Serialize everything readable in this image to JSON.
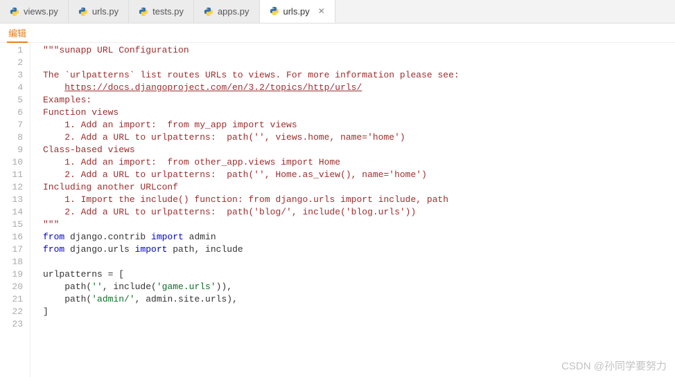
{
  "tabs": [
    {
      "label": "views.py",
      "active": false,
      "closeable": false
    },
    {
      "label": "urls.py",
      "active": false,
      "closeable": false
    },
    {
      "label": "tests.py",
      "active": false,
      "closeable": false
    },
    {
      "label": "apps.py",
      "active": false,
      "closeable": false
    },
    {
      "label": "urls.py",
      "active": true,
      "closeable": true
    }
  ],
  "subbar": {
    "label": "编辑"
  },
  "close_glyph": "✕",
  "code": {
    "lines": [
      {
        "n": 1,
        "segs": [
          {
            "t": "\"\"\"sunapp URL Configuration",
            "cls": "c-docstring"
          }
        ]
      },
      {
        "n": 2,
        "segs": [
          {
            "t": "",
            "cls": "c-docstring"
          }
        ]
      },
      {
        "n": 3,
        "segs": [
          {
            "t": "The `urlpatterns` list routes URLs to views. For more information please see:",
            "cls": "c-docstring"
          }
        ]
      },
      {
        "n": 4,
        "segs": [
          {
            "t": "    ",
            "cls": "c-docstring"
          },
          {
            "t": "https://docs.djangoproject.com/en/3.2/topics/http/urls/",
            "cls": "c-link"
          }
        ]
      },
      {
        "n": 5,
        "segs": [
          {
            "t": "Examples:",
            "cls": "c-docstring"
          }
        ]
      },
      {
        "n": 6,
        "segs": [
          {
            "t": "Function views",
            "cls": "c-docstring"
          }
        ]
      },
      {
        "n": 7,
        "segs": [
          {
            "t": "    1. Add an import:  from my_app import views",
            "cls": "c-docstring"
          }
        ]
      },
      {
        "n": 8,
        "segs": [
          {
            "t": "    2. Add a URL to urlpatterns:  path('', views.home, name='home')",
            "cls": "c-docstring"
          }
        ]
      },
      {
        "n": 9,
        "segs": [
          {
            "t": "Class-based views",
            "cls": "c-docstring"
          }
        ]
      },
      {
        "n": 10,
        "segs": [
          {
            "t": "    1. Add an import:  from other_app.views import Home",
            "cls": "c-docstring"
          }
        ]
      },
      {
        "n": 11,
        "segs": [
          {
            "t": "    2. Add a URL to urlpatterns:  path('', Home.as_view(), name='home')",
            "cls": "c-docstring"
          }
        ]
      },
      {
        "n": 12,
        "segs": [
          {
            "t": "Including another URLconf",
            "cls": "c-docstring"
          }
        ]
      },
      {
        "n": 13,
        "segs": [
          {
            "t": "    1. Import the include() function: from django.urls import include, path",
            "cls": "c-docstring"
          }
        ]
      },
      {
        "n": 14,
        "segs": [
          {
            "t": "    2. Add a URL to urlpatterns:  path('blog/', include('blog.urls'))",
            "cls": "c-docstring"
          }
        ]
      },
      {
        "n": 15,
        "segs": [
          {
            "t": "\"\"\"",
            "cls": "c-docstring"
          }
        ]
      },
      {
        "n": 16,
        "segs": [
          {
            "t": "from ",
            "cls": "c-keyword"
          },
          {
            "t": "django.contrib ",
            "cls": "c-plain"
          },
          {
            "t": "import ",
            "cls": "c-keyword"
          },
          {
            "t": "admin",
            "cls": "c-plain"
          }
        ]
      },
      {
        "n": 17,
        "segs": [
          {
            "t": "from ",
            "cls": "c-keyword"
          },
          {
            "t": "django.urls ",
            "cls": "c-plain"
          },
          {
            "t": "import ",
            "cls": "c-keyword"
          },
          {
            "t": "path, include",
            "cls": "c-plain"
          }
        ]
      },
      {
        "n": 18,
        "segs": [
          {
            "t": "",
            "cls": "c-plain"
          }
        ]
      },
      {
        "n": 19,
        "segs": [
          {
            "t": "urlpatterns = [",
            "cls": "c-plain"
          }
        ]
      },
      {
        "n": 20,
        "segs": [
          {
            "t": "    path(",
            "cls": "c-plain"
          },
          {
            "t": "''",
            "cls": "c-string"
          },
          {
            "t": ", include(",
            "cls": "c-plain"
          },
          {
            "t": "'game.urls'",
            "cls": "c-string"
          },
          {
            "t": ")),",
            "cls": "c-plain"
          }
        ]
      },
      {
        "n": 21,
        "segs": [
          {
            "t": "    path(",
            "cls": "c-plain"
          },
          {
            "t": "'admin/'",
            "cls": "c-string"
          },
          {
            "t": ", admin.site.urls),",
            "cls": "c-plain"
          }
        ]
      },
      {
        "n": 22,
        "segs": [
          {
            "t": "]",
            "cls": "c-plain"
          }
        ]
      },
      {
        "n": 23,
        "segs": [
          {
            "t": "",
            "cls": "c-plain"
          }
        ]
      }
    ]
  },
  "watermark": "CSDN @孙同学要努力"
}
